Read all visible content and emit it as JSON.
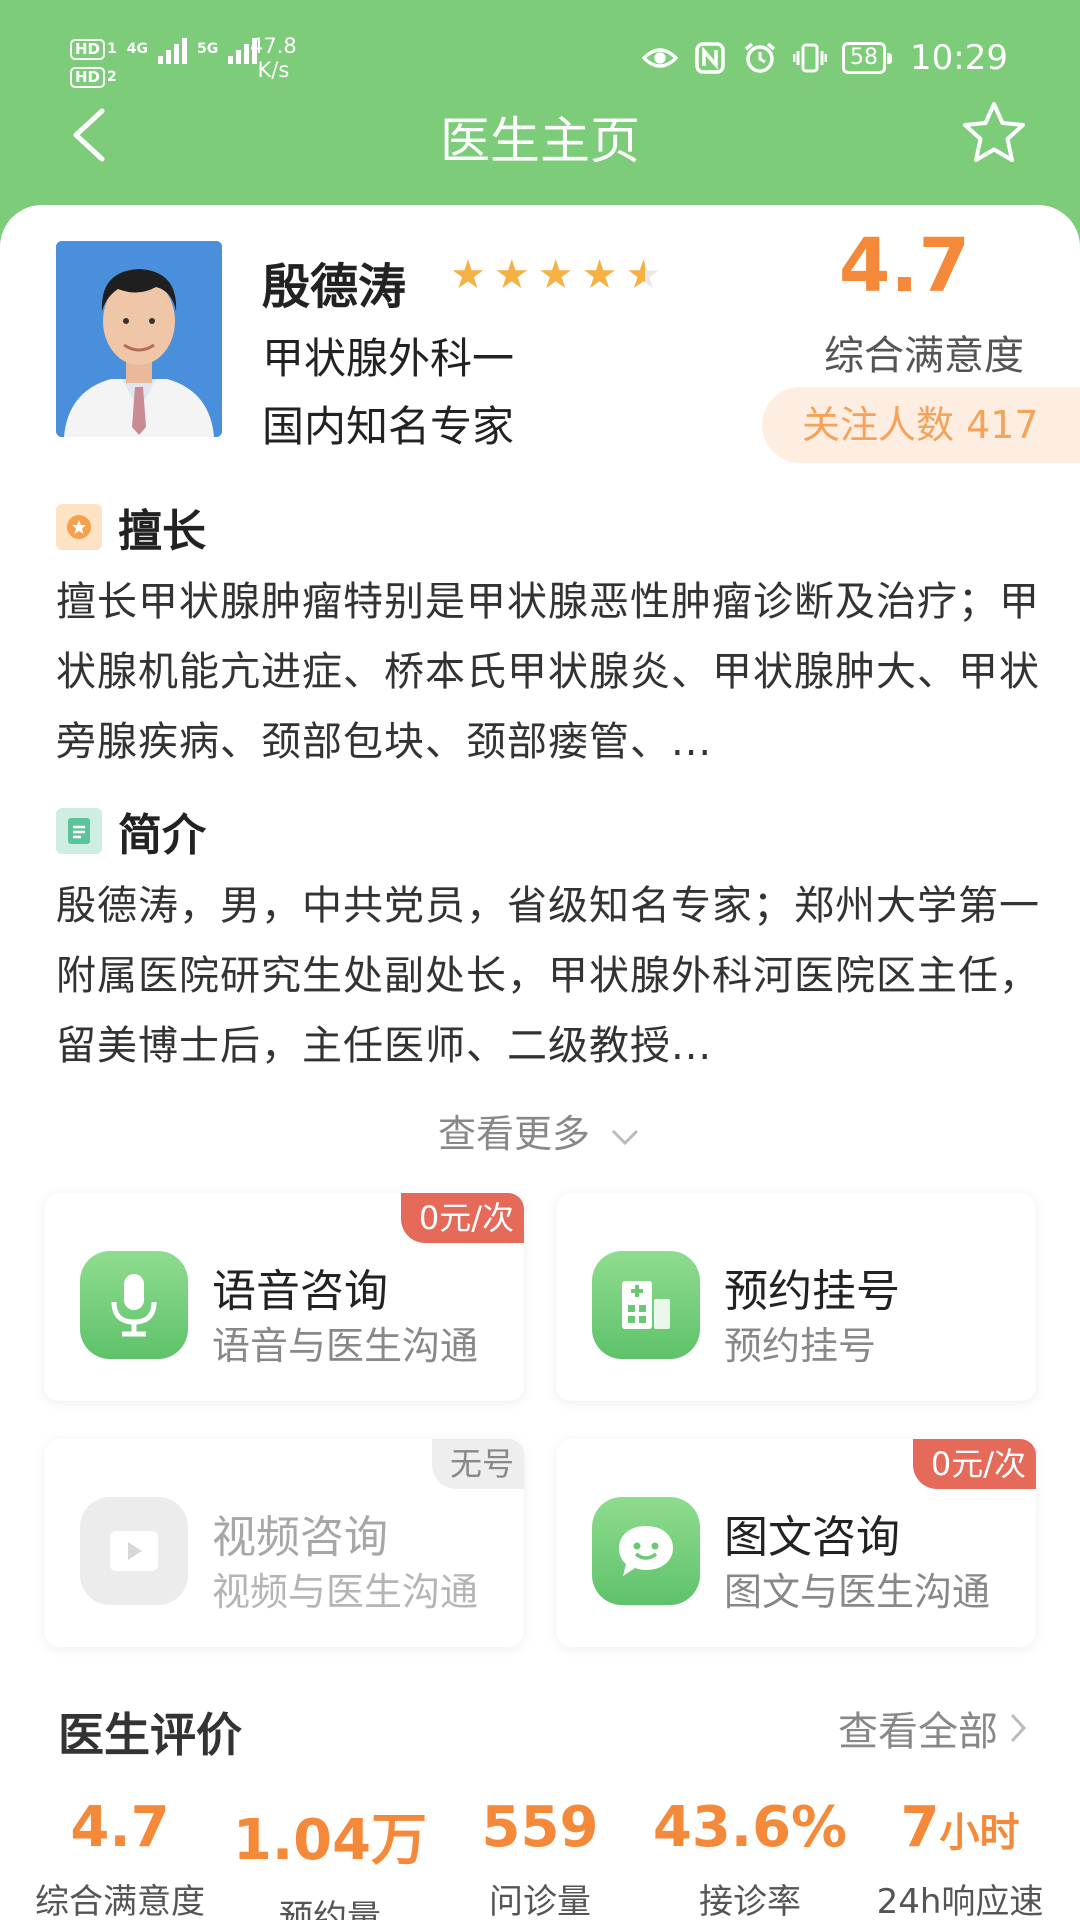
{
  "status_bar": {
    "hd1": "HD",
    "sim1": "1",
    "hd2": "HD",
    "sim2": "2",
    "net1": "4G",
    "net2": "5G",
    "speed_value": "47.8",
    "speed_unit": "K/s",
    "battery": "58",
    "time": "10:29"
  },
  "nav": {
    "title": "医生主页"
  },
  "doctor": {
    "name": "殷德涛",
    "rating_stars": 4.5,
    "department": "甲状腺外科一",
    "title": "国内知名专家",
    "satisfaction_score": "4.7",
    "satisfaction_label": "综合满意度",
    "followers_label": "关注人数 417"
  },
  "specialty": {
    "heading": "擅长",
    "text": "擅长甲状腺肿瘤特别是甲状腺恶性肿瘤诊断及治疗；甲状腺机能亢进症、桥本氏甲状腺炎、甲状腺肿大、甲状旁腺疾病、颈部包块、颈部瘘管、..."
  },
  "intro": {
    "heading": "简介",
    "text": "殷德涛，男，中共党员，省级知名专家；郑州大学第一附属医院研究生处副处长，甲状腺外科河医院区主任，留美博士后，主任医师、二级教授..."
  },
  "more_label": "查看更多",
  "services": [
    {
      "name": "语音咨询",
      "subtitle": "语音与医生沟通",
      "tag": "0元/次"
    },
    {
      "name": "预约挂号",
      "subtitle": "预约挂号",
      "tag": ""
    },
    {
      "name": "视频咨询",
      "subtitle": "视频与医生沟通",
      "tag": "无号"
    },
    {
      "name": "图文咨询",
      "subtitle": "图文与医生沟通",
      "tag": "0元/次"
    }
  ],
  "evaluation": {
    "title": "医生评价",
    "view_all": "查看全部",
    "stats": [
      {
        "value": "4.7",
        "unit": "",
        "label": "综合满意度"
      },
      {
        "value": "1.04万",
        "unit": "",
        "label": "预约量"
      },
      {
        "value": "559",
        "unit": "",
        "label": "问诊量"
      },
      {
        "value": "43.6%",
        "unit": "",
        "label": "接诊率"
      },
      {
        "value": "7",
        "unit": "小时",
        "label": "24h响应速"
      }
    ]
  },
  "colors": {
    "header_green": "#7dcc7a",
    "accent_orange": "#f5893a",
    "tag_red": "#e66a5a",
    "star_gold": "#f6b144"
  }
}
